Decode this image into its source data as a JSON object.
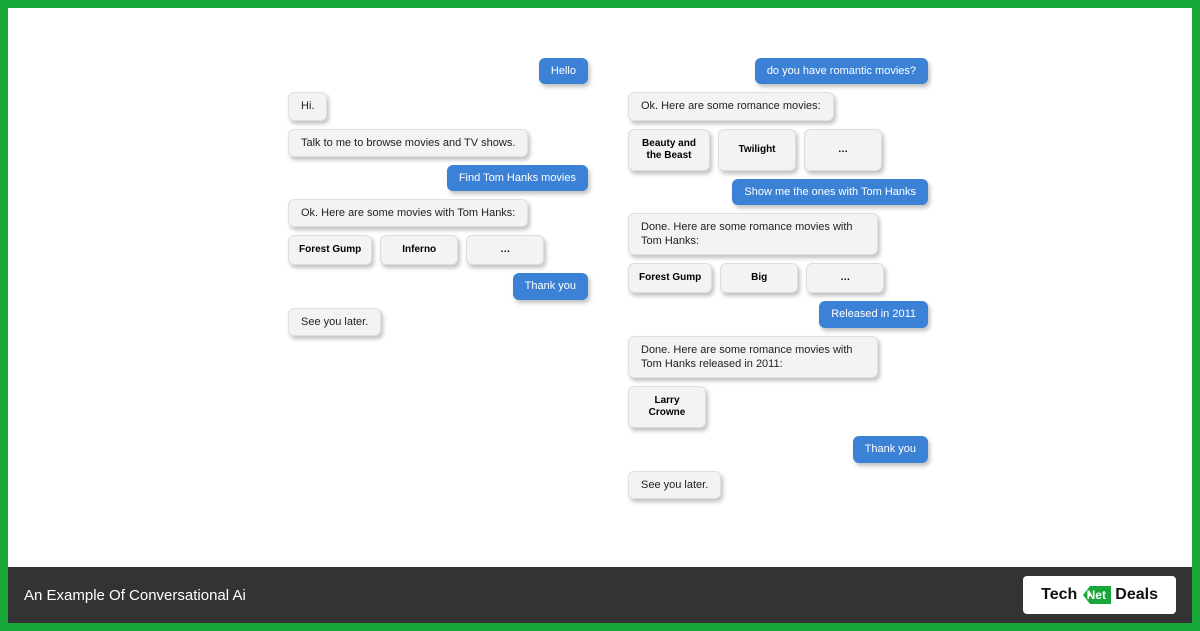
{
  "left_conv": {
    "m0": "Hello",
    "m1": "Hi.",
    "m2": "Talk to me to browse movies and TV shows.",
    "m3": "Find Tom Hanks movies",
    "m4": "Ok. Here are some movies with Tom Hanks:",
    "cards1": {
      "a": "Forest Gump",
      "b": "Inferno",
      "c": "…"
    },
    "m5": "Thank you",
    "m6": "See you later."
  },
  "right_conv": {
    "m0": "do you have romantic movies?",
    "m1": "Ok. Here are some romance movies:",
    "cards1": {
      "a": "Beauty and the Beast",
      "b": "Twilight",
      "c": "…"
    },
    "m2": "Show me the ones with Tom Hanks",
    "m3": "Done. Here are some romance movies with Tom Hanks:",
    "cards2": {
      "a": "Forest Gump",
      "b": "Big",
      "c": "…"
    },
    "m4": "Released in 2011",
    "m5": "Done. Here are some romance movies with Tom Hanks released in 2011:",
    "cards3": {
      "a": "Larry Crowne"
    },
    "m6": "Thank you",
    "m7": "See you later."
  },
  "footer": {
    "title": "An Example Of Conversational Ai",
    "logo_tech": "Tech",
    "logo_net": "Net",
    "logo_deals": "Deals"
  }
}
